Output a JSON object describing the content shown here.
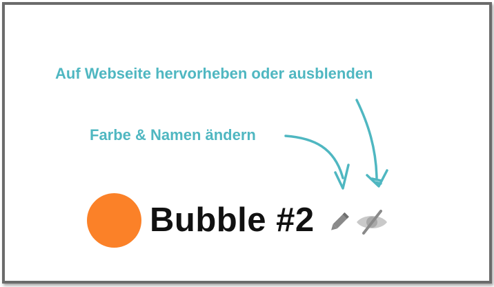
{
  "annotations": {
    "highlight_hide_label": "Auf Webseite hervorheben oder ausblenden",
    "color_name_label": "Farbe & Namen ändern"
  },
  "bubble": {
    "name": "Bubble #2",
    "color": "#fb8128",
    "edit_icon": "pencil-icon",
    "visibility_icon": "eye-slash-icon"
  },
  "colors": {
    "annotation": "#4fb7c1",
    "icon": "#8a8a8a",
    "frame_border": "#6b6b6b"
  }
}
